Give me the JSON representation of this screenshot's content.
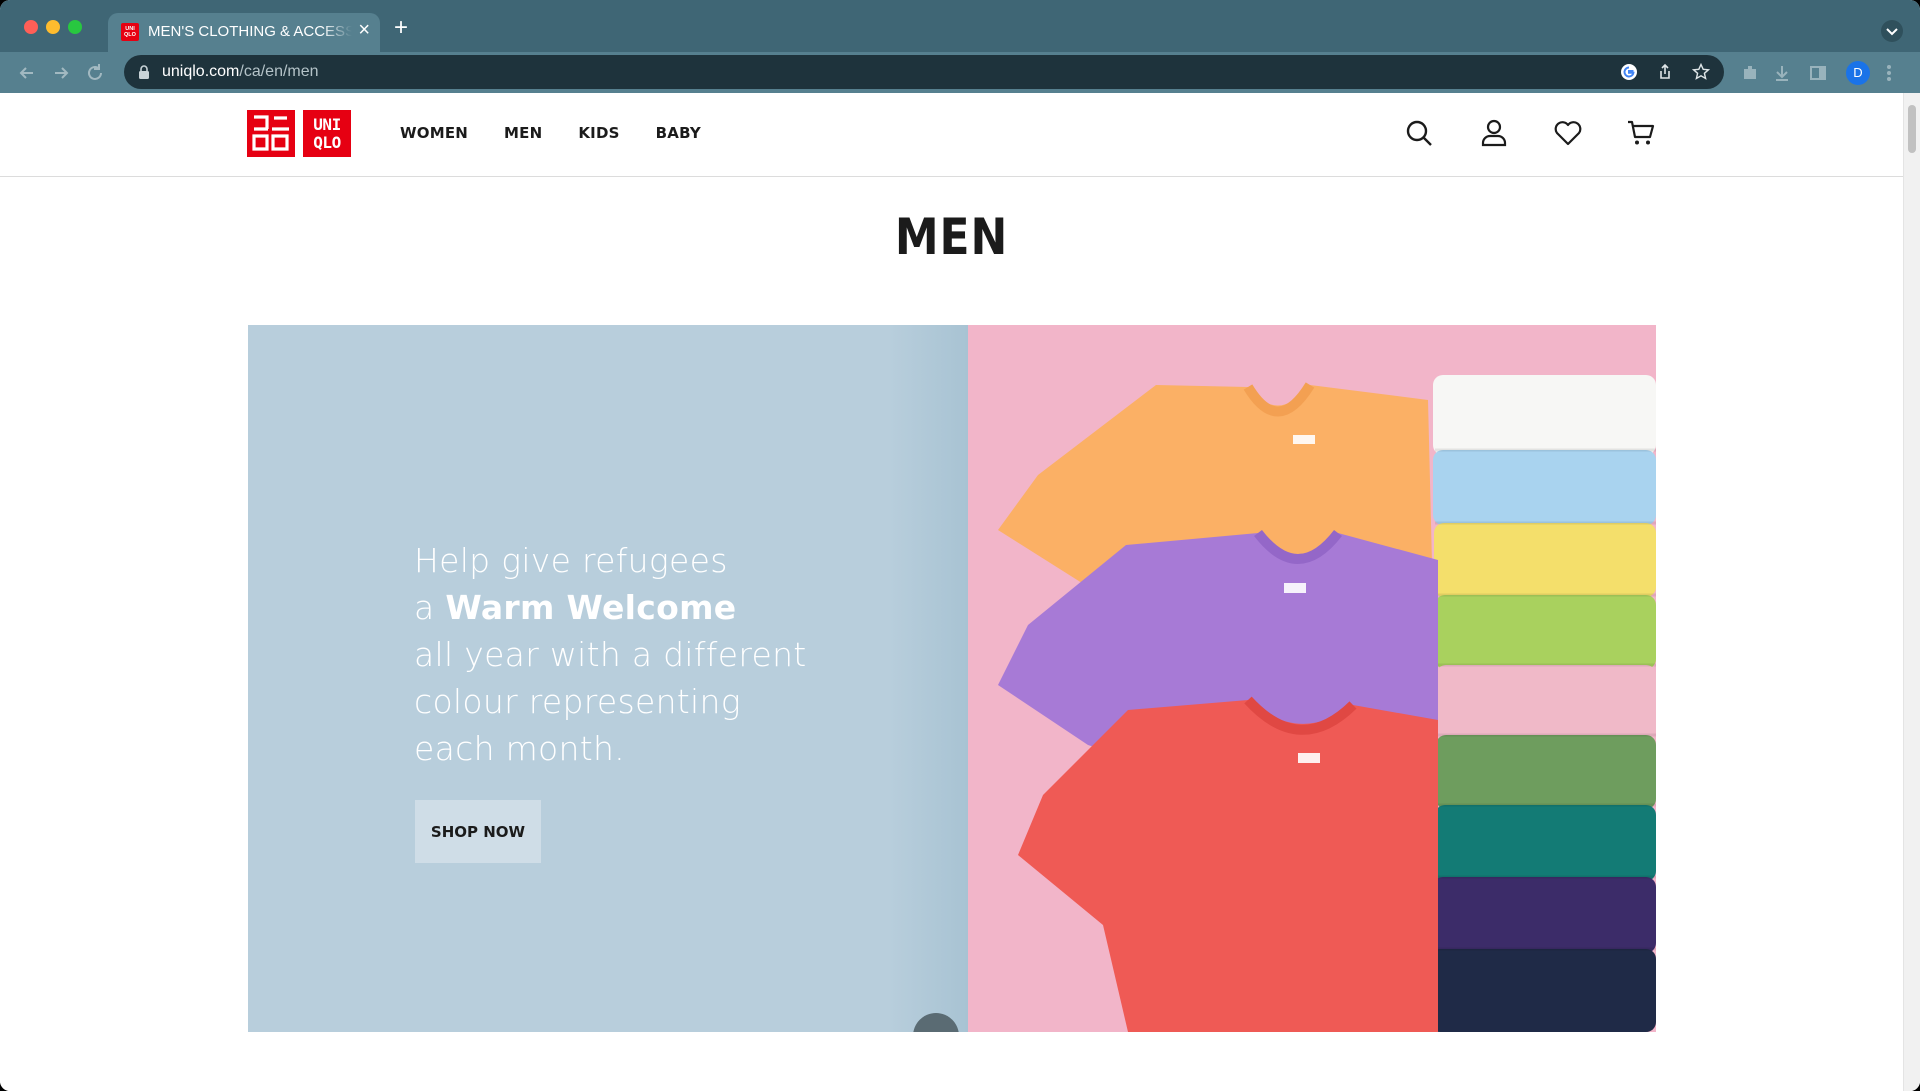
{
  "browser": {
    "tab_title": "MEN'S CLOTHING & ACCESSORIES",
    "tab_favicon_text": "UNI QLO",
    "url_host": "uniqlo.com",
    "url_path": "/ca/en/men",
    "profile_initial": "D"
  },
  "header": {
    "logo_top": "ユニ\nクロ",
    "logo_bottom": "UNI\nQLO",
    "nav": [
      "WOMEN",
      "MEN",
      "KIDS",
      "BABY"
    ],
    "icons": [
      "search-icon",
      "account-icon",
      "wishlist-heart-icon",
      "cart-icon"
    ]
  },
  "page": {
    "title": "MEN"
  },
  "hero": {
    "line1": "Help give refugees",
    "line2_prefix": "a ",
    "line2_bold": "Warm Welcome",
    "line3": "all year with a different",
    "line4": "colour representing",
    "line5": "each month.",
    "cta": "SHOP NOW",
    "colors": {
      "panel": "#b8cedc",
      "background": "#f2b5c9",
      "tshirts": [
        "#fbb065",
        "#a77ad6",
        "#ef5a55"
      ],
      "stack": [
        "#f7f7f5",
        "#a9d3ef",
        "#f4df6b",
        "#a9d15e",
        "#f0b9c8",
        "#6e9d5e",
        "#137b75",
        "#3c2c69",
        "#1f2a47"
      ]
    }
  }
}
